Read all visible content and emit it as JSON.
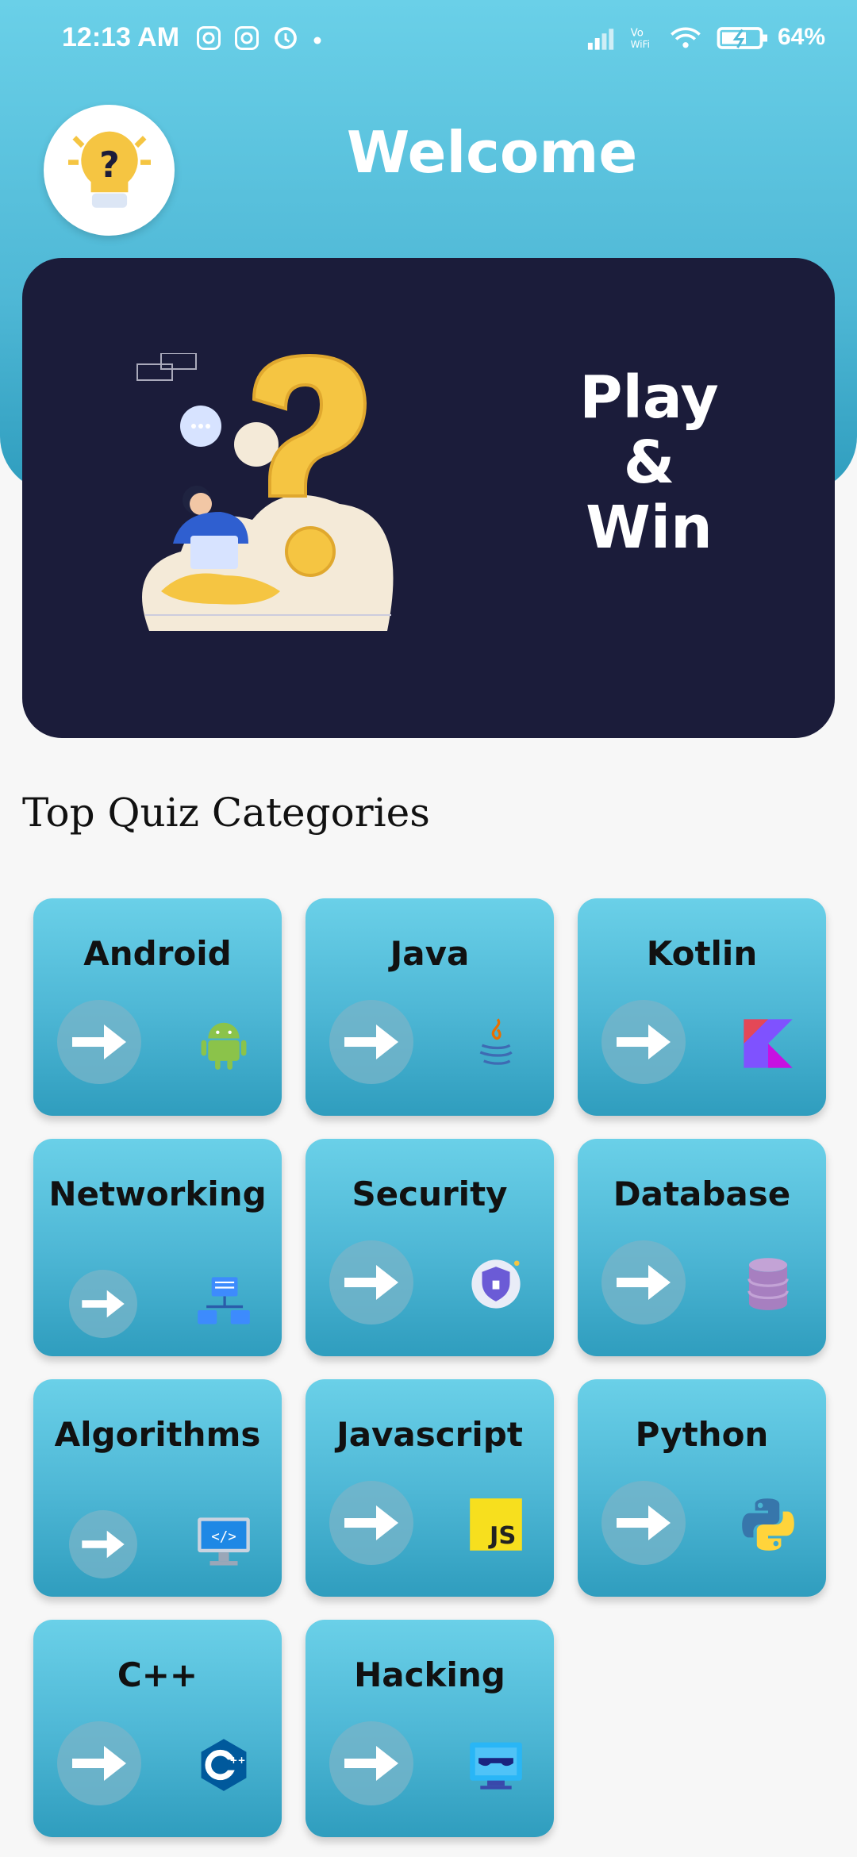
{
  "status_bar": {
    "time": "12:13 AM",
    "battery": "64%"
  },
  "header": {
    "title": "Welcome"
  },
  "banner": {
    "line1": "Play",
    "line2": "&",
    "line3": "Win"
  },
  "section": {
    "title": "Top Quiz Categories"
  },
  "categories": [
    {
      "title": "Android",
      "icon": "android-icon"
    },
    {
      "title": "Java",
      "icon": "java-icon"
    },
    {
      "title": "Kotlin",
      "icon": "kotlin-icon"
    },
    {
      "title": "Networking",
      "icon": "network-icon"
    },
    {
      "title": "Security",
      "icon": "shield-icon"
    },
    {
      "title": "Database",
      "icon": "database-icon"
    },
    {
      "title": "Algorithms",
      "icon": "code-monitor-icon"
    },
    {
      "title": "Javascript",
      "icon": "js-icon"
    },
    {
      "title": "Python",
      "icon": "python-icon"
    },
    {
      "title": "C++",
      "icon": "cpp-icon"
    },
    {
      "title": "Hacking",
      "icon": "hacker-icon"
    }
  ],
  "colors": {
    "accent": "#4fb8d6",
    "banner": "#1b1c3a",
    "bulb": "#f5c542"
  }
}
